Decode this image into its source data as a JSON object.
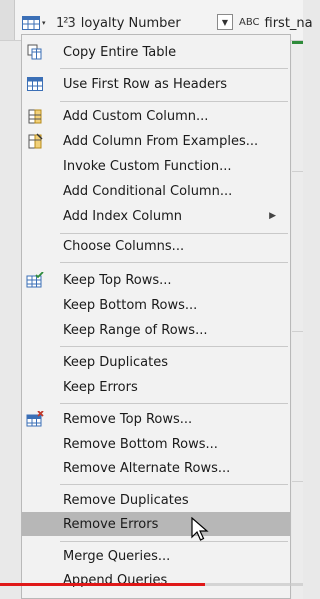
{
  "header": {
    "col1_type": "1²3",
    "col1_name": "loyalty Number",
    "col2_type": "ABC",
    "col2_name": "first_na"
  },
  "menu": {
    "items": [
      {
        "label": "Copy Entire Table",
        "icon": "copy-table-icon"
      },
      {
        "label": "Use First Row as Headers",
        "icon": "table-header-icon"
      },
      {
        "label": "Add Custom Column...",
        "icon": "custom-column-icon"
      },
      {
        "label": "Add Column From Examples...",
        "icon": "column-examples-icon"
      },
      {
        "label": "Invoke Custom Function...",
        "icon": ""
      },
      {
        "label": "Add Conditional Column...",
        "icon": ""
      },
      {
        "label": "Add Index Column",
        "icon": "",
        "submenu": true
      },
      {
        "label": "Choose Columns...",
        "icon": ""
      },
      {
        "label": "Keep Top Rows...",
        "icon": "keep-rows-icon"
      },
      {
        "label": "Keep Bottom Rows...",
        "icon": ""
      },
      {
        "label": "Keep Range of Rows...",
        "icon": ""
      },
      {
        "label": "Keep Duplicates",
        "icon": ""
      },
      {
        "label": "Keep Errors",
        "icon": ""
      },
      {
        "label": "Remove Top Rows...",
        "icon": "remove-rows-icon"
      },
      {
        "label": "Remove Bottom Rows...",
        "icon": ""
      },
      {
        "label": "Remove Alternate Rows...",
        "icon": ""
      },
      {
        "label": "Remove Duplicates",
        "icon": ""
      },
      {
        "label": "Remove Errors",
        "icon": "",
        "highlighted": true
      },
      {
        "label": "Merge Queries...",
        "icon": ""
      },
      {
        "label": "Append Queries",
        "icon": ""
      }
    ]
  },
  "colors": {
    "highlight": "#b7b7b7",
    "menu_bg": "#f2f2f2",
    "progress": "#e01818"
  }
}
